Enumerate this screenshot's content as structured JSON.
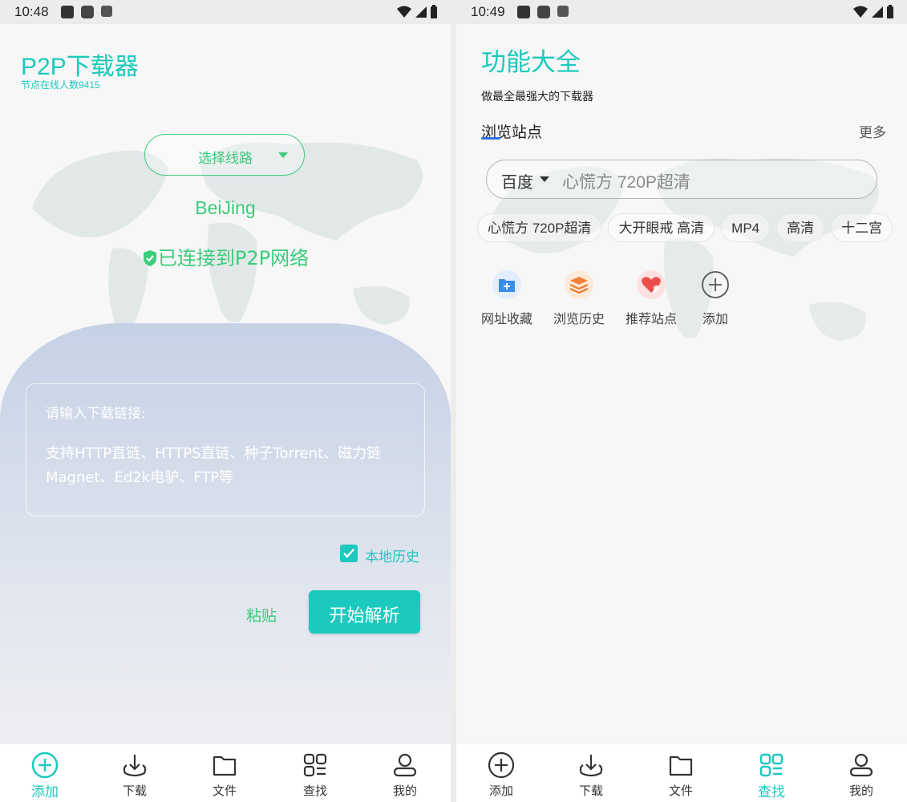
{
  "screens": {
    "left": {
      "status": {
        "time": "10:48"
      },
      "app_title": "P2P下载器",
      "node_count": "节点在线人数9415",
      "route_button": "选择线路",
      "city": "BeiJing",
      "connection_status": "已连接到P2P网络",
      "link_input": {
        "label": "请输入下载链接:",
        "hint": "支持HTTP直链、HTTPS直链、种子Torrent、磁力链Magnet、Ed2k电驴、FTP等"
      },
      "local_history": {
        "label": "本地历史",
        "checked": true
      },
      "paste_label": "粘贴",
      "start_label": "开始解析"
    },
    "right": {
      "status": {
        "time": "10:49"
      },
      "title": "功能大全",
      "subtitle": "做最全最强大的下载器",
      "section_title": "浏览站点",
      "more_label": "更多",
      "search": {
        "engine": "百度",
        "placeholder": "心慌方 720P超清"
      },
      "chips": [
        "心慌方 720P超清",
        "大开眼戒 高清",
        "MP4",
        "高清",
        "十二宫"
      ],
      "shortcuts": [
        {
          "label": "网址收藏",
          "icon": "bookmark-folder-icon"
        },
        {
          "label": "浏览历史",
          "icon": "history-layers-icon"
        },
        {
          "label": "推荐站点",
          "icon": "recommend-heart-icon"
        },
        {
          "label": "添加",
          "icon": "add-circle-icon"
        }
      ]
    }
  },
  "nav": {
    "items": [
      {
        "label": "添加",
        "icon": "add-circle-icon"
      },
      {
        "label": "下载",
        "icon": "download-icon"
      },
      {
        "label": "文件",
        "icon": "folder-icon"
      },
      {
        "label": "查找",
        "icon": "grid-icon"
      },
      {
        "label": "我的",
        "icon": "person-icon"
      }
    ],
    "left_active": 0,
    "right_active": 3
  },
  "colors": {
    "accent": "#1cc9be",
    "green": "#3ccc7c",
    "panel_top": "#c5d1e5",
    "inactive_icon": "#333333",
    "link_underline": "#2b6fe3"
  }
}
